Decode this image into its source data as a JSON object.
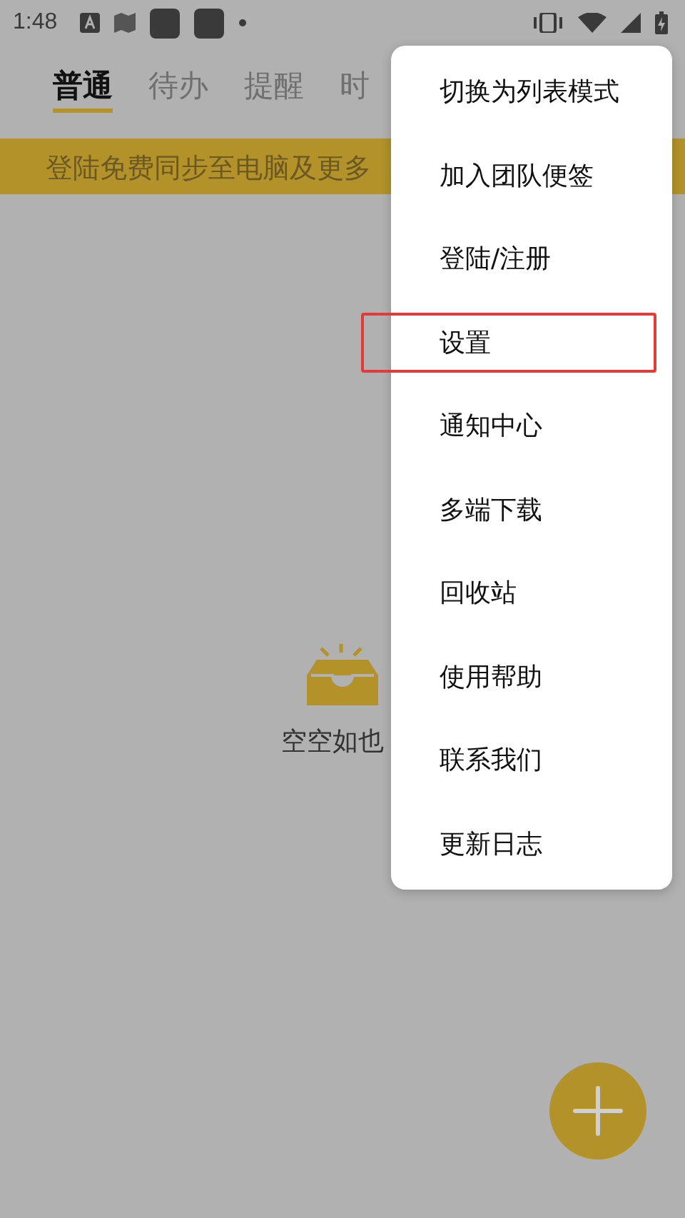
{
  "status_bar": {
    "time": "1:48"
  },
  "tabs": [
    {
      "label": "普通",
      "selected": true
    },
    {
      "label": "待办",
      "selected": false
    },
    {
      "label": "提醒",
      "selected": false
    },
    {
      "label": "时",
      "selected": false
    }
  ],
  "banner": {
    "text": "登陆免费同步至电脑及更多"
  },
  "empty_state": {
    "text": "空空如也"
  },
  "menu": {
    "items": [
      {
        "label": "切换为列表模式",
        "highlighted": false
      },
      {
        "label": "加入团队便签",
        "highlighted": false
      },
      {
        "label": "登陆/注册",
        "highlighted": false
      },
      {
        "label": "设置",
        "highlighted": true
      },
      {
        "label": "通知中心",
        "highlighted": false
      },
      {
        "label": "多端下载",
        "highlighted": false
      },
      {
        "label": "回收站",
        "highlighted": false
      },
      {
        "label": "使用帮助",
        "highlighted": false
      },
      {
        "label": "联系我们",
        "highlighted": false
      },
      {
        "label": "更新日志",
        "highlighted": false
      }
    ]
  }
}
